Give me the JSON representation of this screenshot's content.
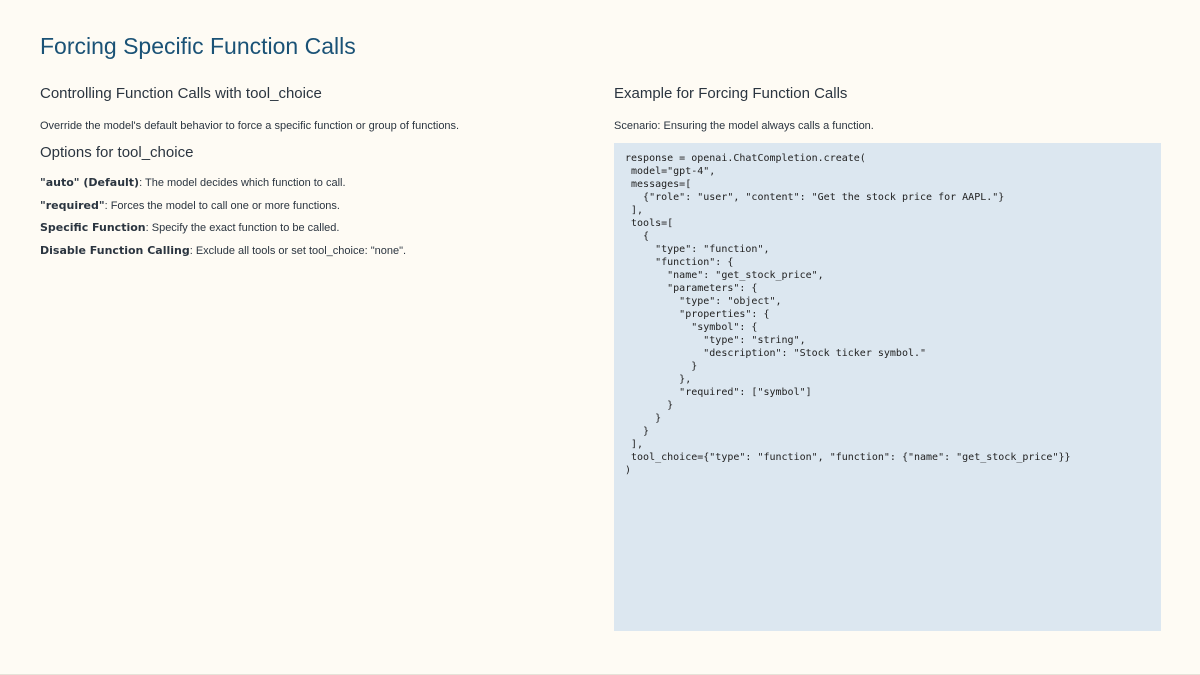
{
  "slide": {
    "title": "Forcing Specific Function Calls"
  },
  "left": {
    "heading": "Controlling Function Calls with tool_choice",
    "description": "Override the model's default behavior to force a specific function or group of functions.",
    "options_heading": "Options for tool_choice",
    "options": [
      {
        "term": "\"auto\" (Default)",
        "text": ": The model decides which function to call."
      },
      {
        "term": "\"required\"",
        "text": ": Forces the model to call one or more functions."
      },
      {
        "term": "Specific Function",
        "text": ": Specify the exact function to be called."
      },
      {
        "term": "Disable Function Calling",
        "text": ": Exclude all tools or set tool_choice: \"none\"."
      }
    ]
  },
  "right": {
    "heading": "Example for Forcing Function Calls",
    "scenario": "Scenario: Ensuring the model always calls a function.",
    "code": "response = openai.ChatCompletion.create(\n model=\"gpt-4\",\n messages=[\n   {\"role\": \"user\", \"content\": \"Get the stock price for AAPL.\"}\n ],\n tools=[\n   {\n     \"type\": \"function\",\n     \"function\": {\n       \"name\": \"get_stock_price\",\n       \"parameters\": {\n         \"type\": \"object\",\n         \"properties\": {\n           \"symbol\": {\n             \"type\": \"string\",\n             \"description\": \"Stock ticker symbol.\"\n           }\n         },\n         \"required\": [\"symbol\"]\n       }\n     }\n   }\n ],\n tool_choice={\"type\": \"function\", \"function\": {\"name\": \"get_stock_price\"}}\n)"
  },
  "colors": {
    "background": "#fefbf4",
    "title": "#1a5276",
    "code_background": "#dce7f0"
  }
}
